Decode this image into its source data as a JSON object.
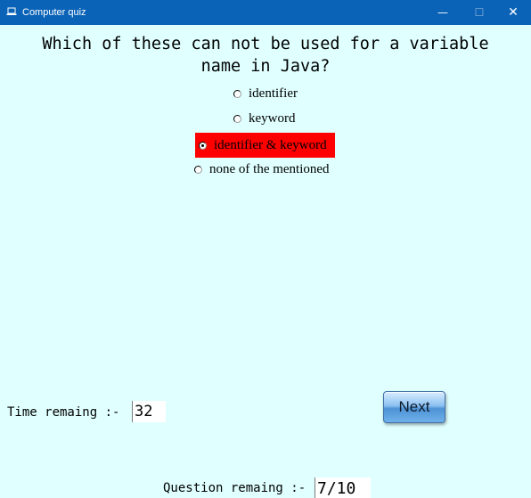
{
  "window": {
    "title": "Computer quiz",
    "icon": "laptop-icon",
    "controls": {
      "minimize": "—",
      "maximize": "☐",
      "close": "✕"
    }
  },
  "quiz": {
    "question": "Which of these can not be used for a variable name in Java?",
    "options": [
      {
        "label": "identifier",
        "selected": false
      },
      {
        "label": "keyword",
        "selected": false
      },
      {
        "label": "identifier & keyword",
        "selected": true
      },
      {
        "label": "none of the mentioned",
        "selected": false
      }
    ],
    "selected_highlight_color": "#ff0000",
    "next_label": "Next"
  },
  "status": {
    "time_label": "Time remaing :-",
    "time_value": "32",
    "question_label": "Question remaing :-",
    "question_value": "7/10"
  },
  "colors": {
    "background": "#e0ffff",
    "titlebar": "#0b63b8"
  }
}
